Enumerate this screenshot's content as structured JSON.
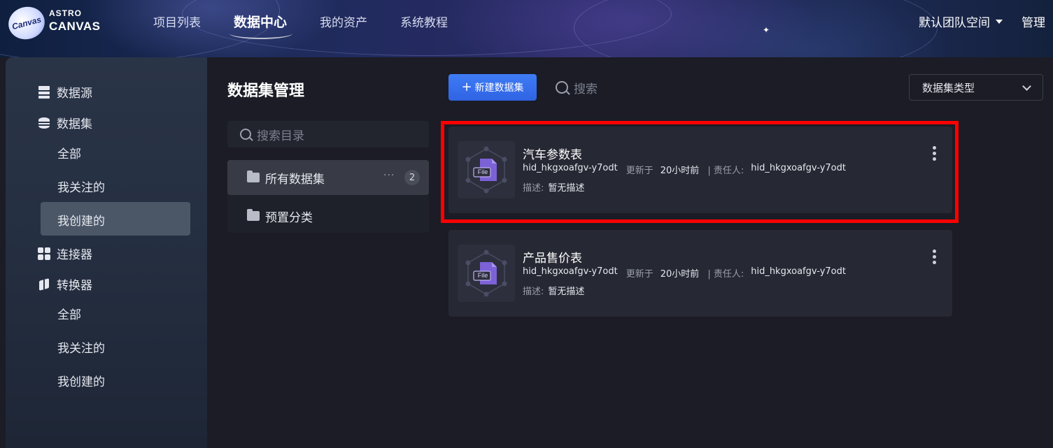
{
  "header": {
    "logo_top": "ASTRO",
    "logo_bottom": "CANVAS",
    "logo_badge": "Canvas",
    "nav": [
      {
        "label": "项目列表"
      },
      {
        "label": "数据中心",
        "active": true
      },
      {
        "label": "我的资产"
      },
      {
        "label": "系统教程"
      }
    ],
    "team": "默认团队空间",
    "manage": "管理"
  },
  "sidebar": {
    "datasource": "数据源",
    "dataset": "数据集",
    "dataset_all": "全部",
    "dataset_followed": "我关注的",
    "dataset_created": "我创建的",
    "connector": "连接器",
    "transformer": "转换器",
    "transformer_all": "全部",
    "transformer_followed": "我关注的",
    "transformer_created": "我创建的"
  },
  "directory": {
    "title": "数据集管理",
    "search_placeholder": "搜索目录",
    "items": [
      {
        "label": "所有数据集",
        "count": "2",
        "more": "···"
      },
      {
        "label": "预置分类"
      }
    ]
  },
  "toolbar": {
    "new_button": "新建数据集",
    "search_placeholder": "搜索",
    "type_select": "数据集类型"
  },
  "datasets": [
    {
      "name": "汽车参数表",
      "owner_id": "hid_hkgxoafgv-y7odt",
      "updated_label": "更新于",
      "updated": "20小时前",
      "responsible_label": "| 责任人:",
      "responsible": "hid_hkgxoafgv-y7odt",
      "desc_label": "描述:",
      "desc": "暂无描述",
      "icon_label": "File"
    },
    {
      "name": "产品售价表",
      "owner_id": "hid_hkgxoafgv-y7odt",
      "updated_label": "更新于",
      "updated": "20小时前",
      "responsible_label": "| 责任人:",
      "responsible": "hid_hkgxoafgv-y7odt",
      "desc_label": "描述:",
      "desc": "暂无描述",
      "icon_label": "File"
    }
  ],
  "colors": {
    "accent_blue": "#3f7cf6",
    "highlight_red": "#ff0000",
    "card_bg": "#262833",
    "sidebar_active": "#4b5767"
  }
}
